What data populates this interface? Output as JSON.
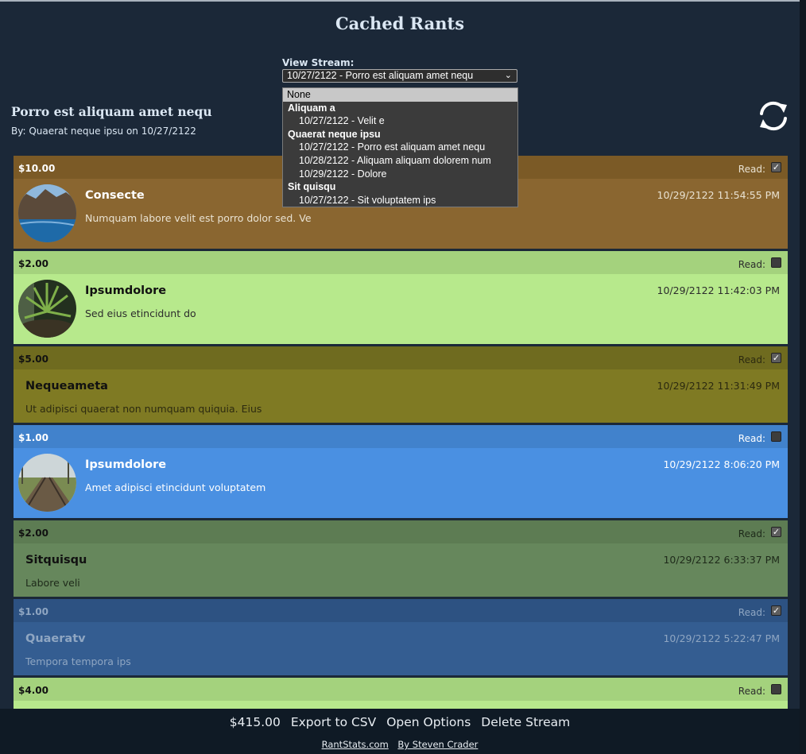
{
  "app_title": "Cached Rants",
  "stream_selector": {
    "label": "View Stream:",
    "selected": "10/27/2122 - Porro est aliquam amet nequ",
    "options": [
      {
        "type": "none",
        "label": "None"
      },
      {
        "type": "group",
        "label": "Aliquam a"
      },
      {
        "type": "option",
        "label": "10/27/2122 - Velit e"
      },
      {
        "type": "group",
        "label": "Quaerat neque ipsu"
      },
      {
        "type": "option",
        "label": "10/27/2122 - Porro est aliquam amet nequ"
      },
      {
        "type": "option",
        "label": "10/28/2122 - Aliquam aliquam dolorem num"
      },
      {
        "type": "option",
        "label": "10/29/2122 - Dolore"
      },
      {
        "type": "group",
        "label": "Sit quisqu"
      },
      {
        "type": "option",
        "label": "10/27/2122 - Sit voluptatem ips"
      }
    ]
  },
  "stream": {
    "title": "Porro est aliquam amet nequ",
    "byline": "By: Quaerat neque ipsu on 10/27/2122"
  },
  "read_label": "Read:",
  "rants": [
    {
      "amount": "$10.00",
      "read": true,
      "user": "Consecte",
      "timestamp": "10/29/2122 11:54:55 PM",
      "message": "Numquam labore velit est porro dolor sed. Ve",
      "avatar": "coast-photo",
      "head_color": "#7b5a26",
      "body_color": "#8a6630",
      "text_color": "#ffffff",
      "meta_color": "#e9e2d2"
    },
    {
      "amount": "$2.00",
      "read": false,
      "user": "Ipsumdolore",
      "timestamp": "10/29/2122 11:42:03 PM",
      "message": "Sed eius etincidunt do",
      "avatar": "plant-photo",
      "head_color": "#a4d27d",
      "body_color": "#b7e98c",
      "text_color": "#111111",
      "meta_color": "#2c2c2c"
    },
    {
      "amount": "$5.00",
      "read": true,
      "user": "Nequeameta",
      "timestamp": "10/29/2122 11:31:49 PM",
      "message": "Ut adipisci quaerat non numquam quiquia. Eius",
      "avatar": "",
      "head_color": "#6f6b1f",
      "body_color": "#7f7a23",
      "text_color": "#111111",
      "meta_color": "#2c2a10"
    },
    {
      "amount": "$1.00",
      "read": false,
      "user": "Ipsumdolore",
      "timestamp": "10/29/2122 8:06:20 PM",
      "message": "Amet adipisci etincidunt voluptatem",
      "avatar": "railway-photo",
      "head_color": "#4182cc",
      "body_color": "#4a90e2",
      "text_color": "#ffffff",
      "meta_color": "#ffffff"
    },
    {
      "amount": "$2.00",
      "read": true,
      "user": "Sitquisqu",
      "timestamp": "10/29/2122 6:33:37 PM",
      "message": "Labore veli",
      "avatar": "",
      "head_color": "#5d7c53",
      "body_color": "#66875c",
      "text_color": "#111111",
      "meta_color": "#1e2a1a"
    },
    {
      "amount": "$1.00",
      "read": true,
      "user": "Quaeratv",
      "timestamp": "10/29/2122 5:22:47 PM",
      "message": "Tempora tempora ips",
      "avatar": "",
      "head_color": "#2d5282",
      "body_color": "#345d91",
      "text_color": "#8fa6c2",
      "meta_color": "#8fa6c2"
    },
    {
      "amount": "$4.00",
      "read": false,
      "user": "",
      "timestamp": "",
      "message": "",
      "avatar": "",
      "head_color": "#a4d27d",
      "body_color": "#b7e98c",
      "text_color": "#111111",
      "meta_color": "#2c2c2c"
    }
  ],
  "footer": {
    "total": "$415.00",
    "export_csv": "Export to CSV",
    "open_options": "Open Options",
    "delete_stream": "Delete Stream",
    "site_link": "RantStats.com",
    "author_link": "By Steven Crader"
  },
  "icons": {
    "refresh": "refresh-icon",
    "dropdown": "chevron-down-icon",
    "checkbox": "checkmark-icon"
  }
}
